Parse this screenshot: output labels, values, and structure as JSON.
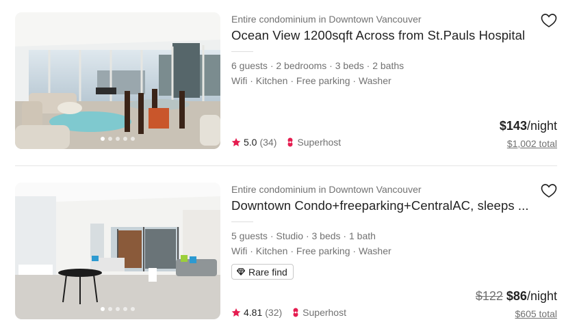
{
  "listings": [
    {
      "subtitle": "Entire condominium in Downtown Vancouver",
      "title": "Ocean View 1200sqft Across from St.Pauls Hospital",
      "details": "6 guests · 2 bedrooms · 3 beds · 2 baths",
      "amenities": "Wifi · Kitchen · Free parking · Washer",
      "rating": "5.0",
      "reviews": "(34)",
      "superhost": "Superhost",
      "price": "$143",
      "per": "/night",
      "total": "$1,002 total",
      "photo_count": 5,
      "photo_index": 0
    },
    {
      "subtitle": "Entire condominium in Downtown Vancouver",
      "title": "Downtown Condo+freeparking+CentralAC, sleeps ...",
      "details": "5 guests · Studio · 3 beds · 1 bath",
      "amenities": "Wifi · Kitchen · Free parking · Washer",
      "badge": "Rare find",
      "rating": "4.81",
      "reviews": "(32)",
      "superhost": "Superhost",
      "old_price": "$122",
      "price": "$86",
      "per": "/night",
      "total": "$605 total",
      "photo_count": 5,
      "photo_index": 0
    }
  ],
  "colors": {
    "star": "#e51d50",
    "superhost": "#e51d50",
    "muted": "#717171",
    "text": "#222222"
  }
}
